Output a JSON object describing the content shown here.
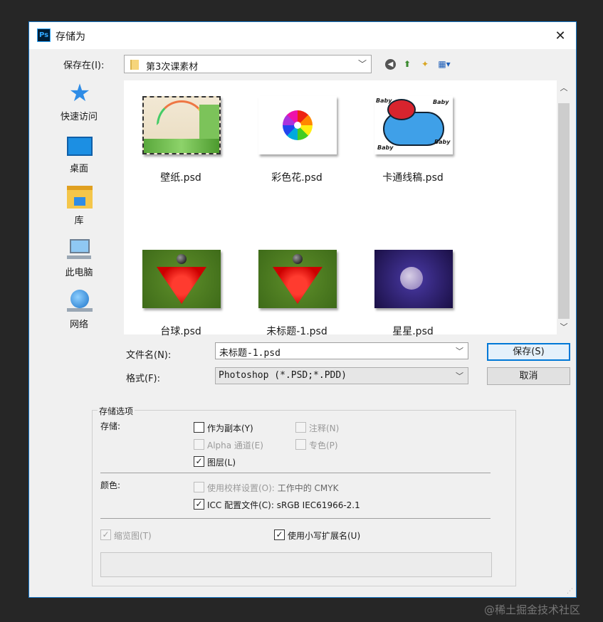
{
  "window": {
    "title": "存储为",
    "app_icon": "Ps",
    "close": "✕"
  },
  "save_in": {
    "label": "保存在(I):",
    "folder": "第3次课素材"
  },
  "toolbar": {
    "back": "◀",
    "up": "⬆",
    "new_folder": "✦",
    "view": "▦▾"
  },
  "places": [
    {
      "label": "快速访问",
      "icon": "quick-access-star-icon"
    },
    {
      "label": "桌面",
      "icon": "desktop-icon"
    },
    {
      "label": "库",
      "icon": "library-icon"
    },
    {
      "label": "此电脑",
      "icon": "computer-icon"
    },
    {
      "label": "网络",
      "icon": "network-icon"
    }
  ],
  "files": [
    {
      "name": "壁纸.psd",
      "thumb": "wallpaper"
    },
    {
      "name": "彩色花.psd",
      "thumb": "flower"
    },
    {
      "name": "卡通线稿.psd",
      "thumb": "cartoon"
    },
    {
      "name": "台球.psd",
      "thumb": "snooker"
    },
    {
      "name": "未标题-1.psd",
      "thumb": "snooker"
    },
    {
      "name": "星星.psd",
      "thumb": "stars"
    }
  ],
  "cartoon_text": "Baby",
  "filename": {
    "label": "文件名(N):",
    "value": "未标题-1.psd"
  },
  "format": {
    "label": "格式(F):",
    "value": "Photoshop (*.PSD;*.PDD)"
  },
  "buttons": {
    "save": "保存(S)",
    "cancel": "取消"
  },
  "options": {
    "title": "存储选项",
    "save_label": "存储:",
    "as_copy": {
      "label": "作为副本(Y)",
      "checked": false,
      "enabled": true
    },
    "notes": {
      "label": "注释(N)",
      "checked": false,
      "enabled": false
    },
    "alpha": {
      "label": "Alpha 通道(E)",
      "checked": false,
      "enabled": false
    },
    "spot": {
      "label": "专色(P)",
      "checked": false,
      "enabled": false
    },
    "layers": {
      "label": "图层(L)",
      "checked": true,
      "enabled": true
    },
    "color_label": "颜色:",
    "proof": {
      "label": "使用校样设置(O):",
      "extra": "工作中的 CMYK",
      "checked": false,
      "enabled": false
    },
    "icc": {
      "label": "ICC 配置文件(C):",
      "extra": "sRGB IEC61966-2.1",
      "checked": true,
      "enabled": true
    },
    "thumbnail": {
      "label": "缩览图(T)",
      "checked": true,
      "enabled": false
    },
    "lowercase": {
      "label": "使用小写扩展名(U)",
      "checked": true,
      "enabled": true
    }
  },
  "watermark": "@稀土掘金技术社区",
  "colors": {
    "accent": "#0078d7",
    "border": "#1979ca"
  }
}
